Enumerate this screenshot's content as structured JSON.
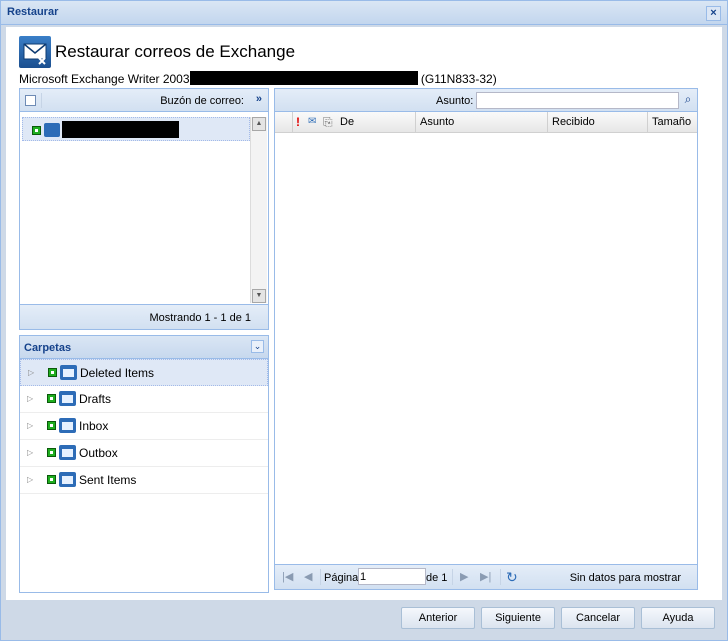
{
  "window": {
    "title": "Restaurar",
    "close_icon": "close-icon"
  },
  "header": {
    "title": "Restaurar correos de Exchange",
    "subtitle_prefix": "Microsoft Exchange Writer 2003",
    "subtitle_suffix": "(G11N833-32)"
  },
  "mailbox_panel": {
    "label": "Buzón de correo:",
    "collapse": "»",
    "status": "Mostrando 1 - 1 de 1"
  },
  "folders_panel": {
    "title": "Carpetas",
    "items": [
      {
        "label": "Deleted Items"
      },
      {
        "label": "Drafts"
      },
      {
        "label": "Inbox"
      },
      {
        "label": "Outbox"
      },
      {
        "label": "Sent Items"
      }
    ]
  },
  "messages_panel": {
    "search_label": "Asunto:",
    "search_value": "",
    "columns": [
      "De",
      "Asunto",
      "Recibido",
      "Tamaño"
    ],
    "pager": {
      "page_label": "Página",
      "page_value": "1",
      "of_label": "de 1",
      "empty_text": "Sin datos para mostrar"
    }
  },
  "buttons": {
    "previous": "Anterior",
    "next": "Siguiente",
    "cancel": "Cancelar",
    "help": "Ayuda"
  },
  "colors": {
    "accent": "#15428b",
    "border": "#99bbe8",
    "selection": "#dfe8f6",
    "status_green": "#1fae1f"
  }
}
